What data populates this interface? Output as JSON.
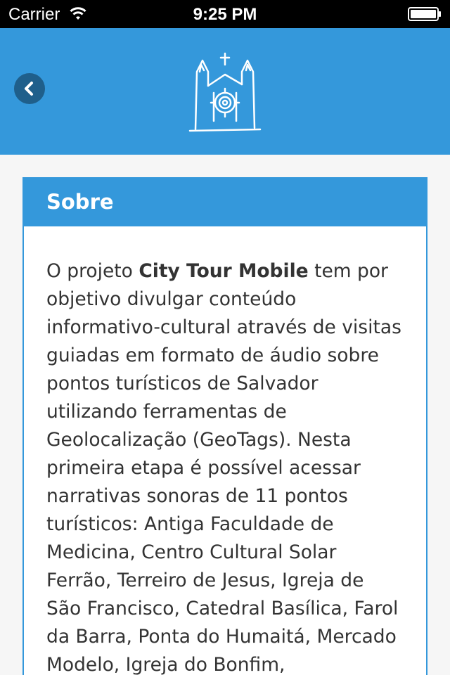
{
  "status_bar": {
    "carrier": "Carrier",
    "time": "9:25 PM"
  },
  "nav": {
    "back_icon": "chevron-left-icon",
    "logo_icon": "cathedral-logo-icon"
  },
  "card": {
    "title": "Sobre",
    "body_prefix": "O projeto ",
    "body_highlight": "City Tour Mobile",
    "body_text": " tem por objetivo divulgar conteúdo informativo-cultural através de visitas guiadas em formato de áudio sobre pontos turísticos de Salvador utilizando ferramentas de Geolocalização (GeoTags). Nesta primeira etapa é possível acessar narrativas sonoras de 11 pontos turísticos: Antiga Faculdade de Medicina, Centro Cultural Solar Ferrão, Terreiro de Jesus, Igreja de São Francisco, Catedral Basílica, Farol da Barra, Ponta do Humaitá, Mercado Modelo, Igreja do Bonfim,"
  },
  "colors": {
    "primary": "#3498db",
    "back_button": "#1f5f8b",
    "status_bar": "#000000"
  }
}
